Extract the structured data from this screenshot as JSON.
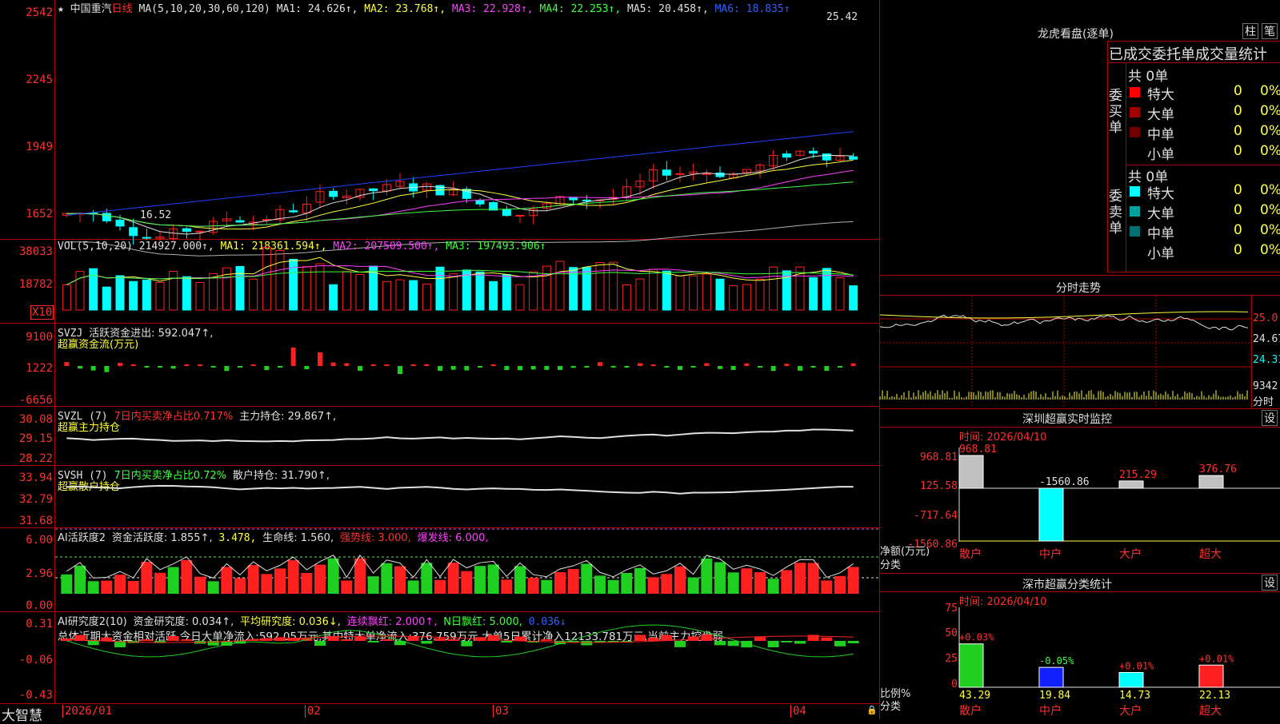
{
  "header": {
    "star": "★",
    "stock_name": "中国重汽",
    "period": "日线",
    "ma_params": "MA(5,10,20,30,60,120)",
    "ma1": "MA1: 24.626↑,",
    "ma2": "MA2: 23.768↑,",
    "ma3": "MA3: 22.928↑,",
    "ma4": "MA4: 22.253↑,",
    "ma5": "MA5: 20.458↑,",
    "ma6": "MA6: 18.835↑",
    "high_mark": "25.42",
    "low_mark": "16.52"
  },
  "price_axis": [
    "2542",
    "2245",
    "1949",
    "1652"
  ],
  "vol": {
    "label": "VOL(5,10,20)",
    "value": "214927.000↑,",
    "ma1": "MA1: 218361.594↑,",
    "ma2": "MA2: 207509.500↑,",
    "ma3": "MA3: 197493.906↑",
    "axis": [
      "38033",
      "18782"
    ],
    "unit": "X10"
  },
  "svzj": {
    "label": "SVZJ",
    "desc": "活跃资金进出: 592.047↑,",
    "title": "超赢资金流(万元)",
    "axis": [
      "9100",
      "1222",
      "-6656"
    ]
  },
  "svzl": {
    "label": "SVZL (7)",
    "desc": "7日内买卖净占比0.717%",
    "hold": "主力持仓: 29.867↑,",
    "title": "超赢主力持仓",
    "axis": [
      "30.08",
      "29.15",
      "28.22"
    ]
  },
  "svsh": {
    "label": "SVSH (7)",
    "desc": "7日内买卖净占比0.72%",
    "hold": "散户持仓: 31.790↑,",
    "title": "超赢散户持仓",
    "axis": [
      "33.94",
      "32.79",
      "31.68"
    ]
  },
  "ai1": {
    "label": "AI活跃度2",
    "a": "资金活跃度: 1.855↑,",
    "b": "3.478,",
    "c": "生命线: 1.560,",
    "d": "强势线: 3.000,",
    "e": "爆发线: 6.000,",
    "axis": [
      "6.00",
      "2.96",
      "0.00"
    ]
  },
  "ai2": {
    "label": "AI研究度2(10)",
    "a": "资金研究度: 0.034↑,",
    "b": "平均研究度: 0.036↓,",
    "c": "连续飘红: 2.000↑,",
    "d": "N日飘红: 5.000,",
    "e": "0.036↓",
    "summary": "总体近期大资金相对活跃,今日大单净流入:592.05万元,其中特大单净流入:376.759万元,大单5日累计净入12133.781万元,当前主力控盘弱",
    "axis": [
      "0.31",
      "-0.06",
      "-0.43"
    ]
  },
  "xaxis": {
    "brand": "大智慧",
    "labels": [
      "2026/01",
      "02",
      "03",
      "04"
    ]
  },
  "dragon": {
    "title": "龙虎看盘(逐单)",
    "btn1": "柱",
    "btn2": "笔",
    "subtitle": "已成交委托单成交量统计",
    "buy_label": "委买单",
    "sell_label": "委卖单",
    "buy_total": "共 0单",
    "sell_total": "共 0单",
    "buy_rows": [
      {
        "name": "特大",
        "count": "0",
        "pct": "0%",
        "color": "#ff0000"
      },
      {
        "name": "大单",
        "count": "0",
        "pct": "0%",
        "color": "#a00000"
      },
      {
        "name": "中单",
        "count": "0",
        "pct": "0%",
        "color": "#700000"
      },
      {
        "name": "小单",
        "count": "0",
        "pct": "0%",
        "color": "#000000"
      }
    ],
    "sell_rows": [
      {
        "name": "特大",
        "count": "0",
        "pct": "0%",
        "color": "#00ffff"
      },
      {
        "name": "大单",
        "count": "0",
        "pct": "0%",
        "color": "#00a0a0"
      },
      {
        "name": "中单",
        "count": "0",
        "pct": "0%",
        "color": "#007070"
      },
      {
        "name": "小单",
        "count": "0",
        "pct": "0%",
        "color": "#000000"
      }
    ]
  },
  "intraday": {
    "title": "分时走势",
    "axis": [
      "25.0",
      "24.67",
      "24.31",
      "9342"
    ],
    "unit": "分时"
  },
  "monitor": {
    "title": "深圳超赢实时监控",
    "btn": "设",
    "time": "时间: 2026/04/10",
    "axis": [
      "968.81",
      "125.58",
      "-717.64",
      "-1560.86"
    ],
    "ylabel": "净额(万元)",
    "xlabel": "分类",
    "bars": [
      {
        "name": "散户",
        "value": 968.81,
        "label": "968.81"
      },
      {
        "name": "中户",
        "value": -1560.86,
        "label": "-1560.86"
      },
      {
        "name": "大户",
        "value": 215.29,
        "label": "215.29"
      },
      {
        "name": "超大",
        "value": 376.76,
        "label": "376.76"
      }
    ]
  },
  "classify": {
    "title": "深市超赢分类统计",
    "btn": "设",
    "time": "时间: 2026/04/10",
    "axis": [
      "75",
      "50",
      "25",
      "0"
    ],
    "ylabel": "比例%",
    "xlabel": "分类",
    "bars": [
      {
        "name": "散户",
        "value": 43.29,
        "label": "43.29",
        "delta": "+0.03%",
        "color": "#20d020"
      },
      {
        "name": "中户",
        "value": 19.84,
        "label": "19.84",
        "delta": "-0.05%",
        "color": "#1020ff"
      },
      {
        "name": "大户",
        "value": 14.73,
        "label": "14.73",
        "delta": "+0.01%",
        "color": "#00ffff"
      },
      {
        "name": "超大",
        "value": 22.13,
        "label": "22.13",
        "delta": "+0.01%",
        "color": "#ff2020"
      }
    ]
  },
  "colors": {
    "up": "#ff2020",
    "down": "#00ffff",
    "grid": "#b00000"
  }
}
